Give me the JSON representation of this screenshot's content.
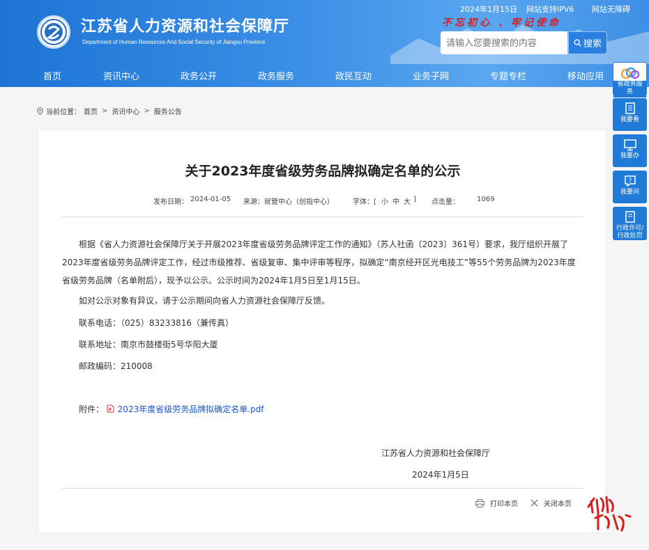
{
  "header": {
    "title": "江苏省人力资源和社会保障厅",
    "subtitle": "Department of Human Resources And Social Security of Jiangsu Province",
    "date": "2024年1月15日",
    "ipv6": "网站支持IPV6",
    "accessible": "网站无障碍",
    "slogan": "不忘初心 、牢记使命",
    "search_placeholder": "请输入您要搜索的内容",
    "search_button": "搜索"
  },
  "nav": [
    "首页",
    "资讯中心",
    "政务公开",
    "政务服务",
    "政民互动",
    "业务子网",
    "专题专栏",
    "移动应用"
  ],
  "breadcrumb": {
    "prefix": "当前位置：",
    "items": [
      "首页",
      "资讯中心",
      "服务公告"
    ]
  },
  "article": {
    "title": "关于2023年度省级劳务品牌拟确定名单的公示",
    "meta": {
      "date_label": "发布日期：",
      "date": "2024-01-05",
      "source_label": "来源：",
      "source": "就管中心（创指中心）",
      "font_label": "字体：[",
      "font_small": "小",
      "font_medium": "中",
      "font_large": "大",
      "font_end": "]",
      "clicks_label": "点击量：",
      "clicks": "1069"
    },
    "para1": "根据《省人力资源社会保障厅关于开展2023年度省级劳务品牌评定工作的通知》（苏人社函〔2023〕361号）要求，我厅组织开展了2023年度省级劳务品牌评定工作，经过市级推荐、省级复审、集中评审等程序，拟确定“南京经开区光电技工”等55个劳务品牌为2023年度省级劳务品牌（名单附后），现予以公示。公示时间为2024年1月5日至1月15日。",
    "para2": "如对公示对象有异议，请于公示期间向省人力资源社会保障厅反馈。",
    "phone": "联系电话：（025）83233816（兼传真）",
    "address": "联系地址：南京市鼓楼街5号华阳大厦",
    "postcode": "邮政编码：210008",
    "attachment_label": "附件：",
    "attachment": "2023年度省级劳务品牌拟确定名单.pdf",
    "signature": "江苏省人力资源和社会保障厅",
    "sign_date": "2024年1月5日",
    "print": "打印本页",
    "close": "关闭本页"
  },
  "sidebar": [
    {
      "label": "省政务服务",
      "icon": "rings-icon"
    },
    {
      "label": "我要看",
      "icon": "book-icon"
    },
    {
      "label": "我要办",
      "icon": "monitor-icon"
    },
    {
      "label": "我要问",
      "icon": "question-icon"
    },
    {
      "label": "行政许可/行政处罚",
      "icon": "document-icon"
    }
  ],
  "colors": {
    "header": "#2f86e2",
    "link": "#1b56c9",
    "slogan": "#d62020",
    "sidebar": "#1f7ad8"
  }
}
